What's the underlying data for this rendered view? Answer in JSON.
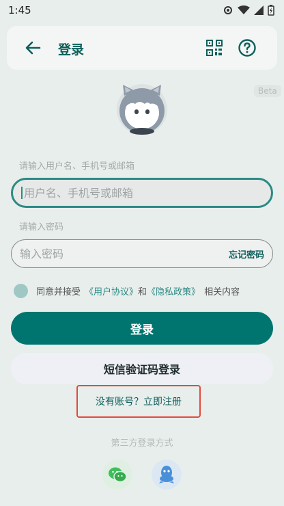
{
  "status_bar": {
    "time": "1:45"
  },
  "app_bar": {
    "title": "登录"
  },
  "badge": {
    "beta": "Beta"
  },
  "username": {
    "label": "请输入用户名、手机号或邮箱",
    "placeholder": "用户名、手机号或邮箱",
    "value": ""
  },
  "password": {
    "label": "请输入密码",
    "placeholder": "输入密码",
    "value": "",
    "forgot_label": "忘记密码"
  },
  "agreement": {
    "prefix": "同意并接受",
    "user_agreement": "《用户协议》",
    "and": "和",
    "privacy_policy": "《隐私政策》",
    "suffix": "相关内容",
    "checked": false
  },
  "buttons": {
    "login": "登录",
    "sms_login": "短信验证码登录",
    "register": "没有账号？立即注册"
  },
  "third_party": {
    "label": "第三方登录方式",
    "providers": [
      "wechat-icon",
      "qq-icon"
    ]
  },
  "colors": {
    "primary": "#00756f",
    "accent": "#2c8a84",
    "highlight_box": "#e24a3b"
  }
}
